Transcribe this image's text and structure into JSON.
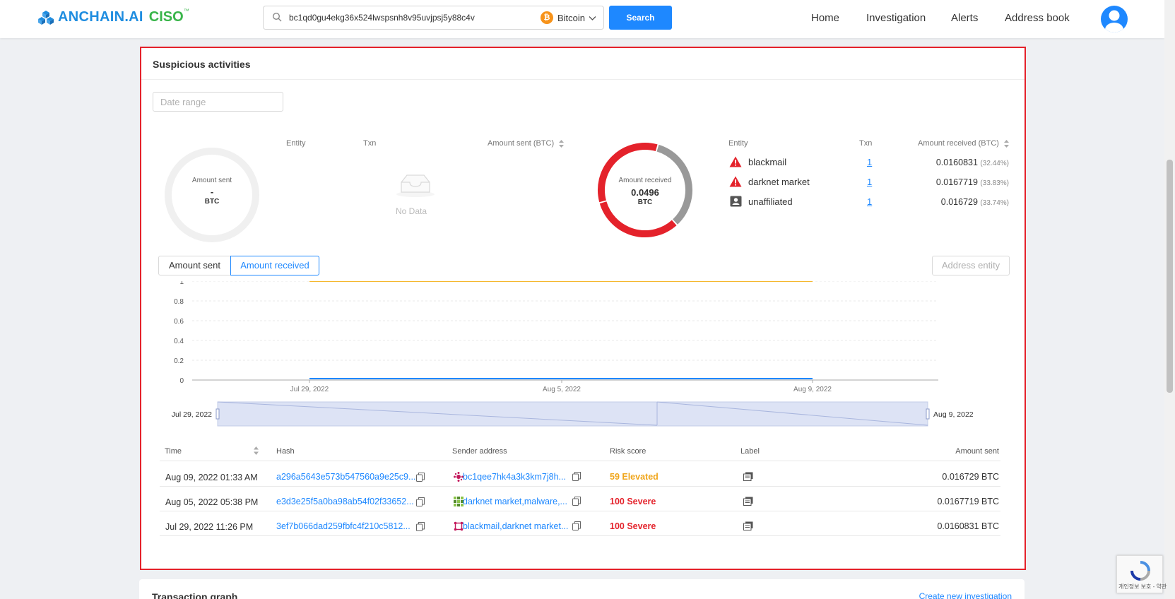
{
  "header": {
    "brand": "ANCHAIN.AI",
    "brand_suffix": "CISO",
    "brand_tm": "™",
    "search_value": "bc1qd0gu4ekg36x524lwspsnh8v95uvjpsj5y88c4v",
    "coin_symbol": "₿",
    "coin": "Bitcoin",
    "search_button": "Search",
    "nav": [
      "Home",
      "Investigation",
      "Alerts",
      "Address book"
    ]
  },
  "panel": {
    "title": "Suspicious activities",
    "date_range_placeholder": "Date range",
    "sent_donut": {
      "label": "Amount sent",
      "value": "-",
      "unit": "BTC"
    },
    "received_donut": {
      "label": "Amount received",
      "value": "0.0496",
      "unit": "BTC"
    },
    "sent_table_headers": [
      "Entity",
      "Txn",
      "Amount sent (BTC)"
    ],
    "no_data": "No Data",
    "received_table_headers": [
      "Entity",
      "Txn",
      "Amount received (BTC)"
    ],
    "received_entities": [
      {
        "entity": "blackmail",
        "txn": "1",
        "amount": "0.0160831",
        "pct": "(32.44%)",
        "icon": "warning-icon"
      },
      {
        "entity": "darknet market",
        "txn": "1",
        "amount": "0.0167719",
        "pct": "(33.83%)",
        "icon": "warning-icon"
      },
      {
        "entity": "unaffiliated",
        "txn": "1",
        "amount": "0.016729",
        "pct": "(33.74%)",
        "icon": "id-card-icon"
      }
    ],
    "toggle_sent": "Amount sent",
    "toggle_received": "Amount received",
    "address_entity_placeholder": "Address entity",
    "table_headers": [
      "Time",
      "Hash",
      "Sender address",
      "Risk score",
      "Label",
      "Amount sent"
    ],
    "rows": [
      {
        "time": "Aug 09, 2022 01:33 AM",
        "hash": "a296a5643e573b547560a9e25c9...",
        "sender": "bc1qee7hk4a3k3km7j8h...",
        "risk": "59 Elevated",
        "risk_level": "elevated",
        "amount": "0.016729 BTC"
      },
      {
        "time": "Aug 05, 2022 05:38 PM",
        "hash": "e3d3e25f5a0ba98ab54f02f33652...",
        "sender": "darknet market,malware,...",
        "risk": "100 Severe",
        "risk_level": "severe",
        "amount": "0.0167719 BTC"
      },
      {
        "time": "Jul 29, 2022 11:26 PM",
        "hash": "3ef7b066dad259fbfc4f210c5812...",
        "sender": "blackmail,darknet market...",
        "risk": "100 Severe",
        "risk_level": "severe",
        "amount": "0.0160831 BTC"
      }
    ]
  },
  "chart_data": {
    "type": "line",
    "x": [
      "Jul 29, 2022",
      "Aug 5, 2022",
      "Aug 9, 2022"
    ],
    "series": [
      {
        "values": [
          1,
          1,
          1
        ],
        "color": "#f5b82e"
      },
      {
        "values": [
          0,
          0,
          0
        ],
        "color": "#1e88ff"
      }
    ],
    "ylim": [
      0,
      1
    ],
    "yticks": [
      "1",
      "0.8",
      "0.6",
      "0.4",
      "0.2",
      "0"
    ],
    "xticks": [
      "Jul 29, 2022",
      "Aug 5, 2022",
      "Aug 9, 2022"
    ],
    "range_start": "Jul 29, 2022",
    "range_end": "Aug 9, 2022",
    "grid": true,
    "received_slices": [
      0.3244,
      0.3383,
      0.3374
    ]
  },
  "panel2": {
    "title": "Transaction graph",
    "link": "Create new investigation"
  },
  "recaptcha": {
    "text": "개인정보 보호 - 약관"
  },
  "colors": {
    "accent": "#1e88ff",
    "severe": "#e4222b",
    "elevated": "#f0a61c",
    "brand": "#1f8de0",
    "brand_suffix": "#39b54a"
  }
}
